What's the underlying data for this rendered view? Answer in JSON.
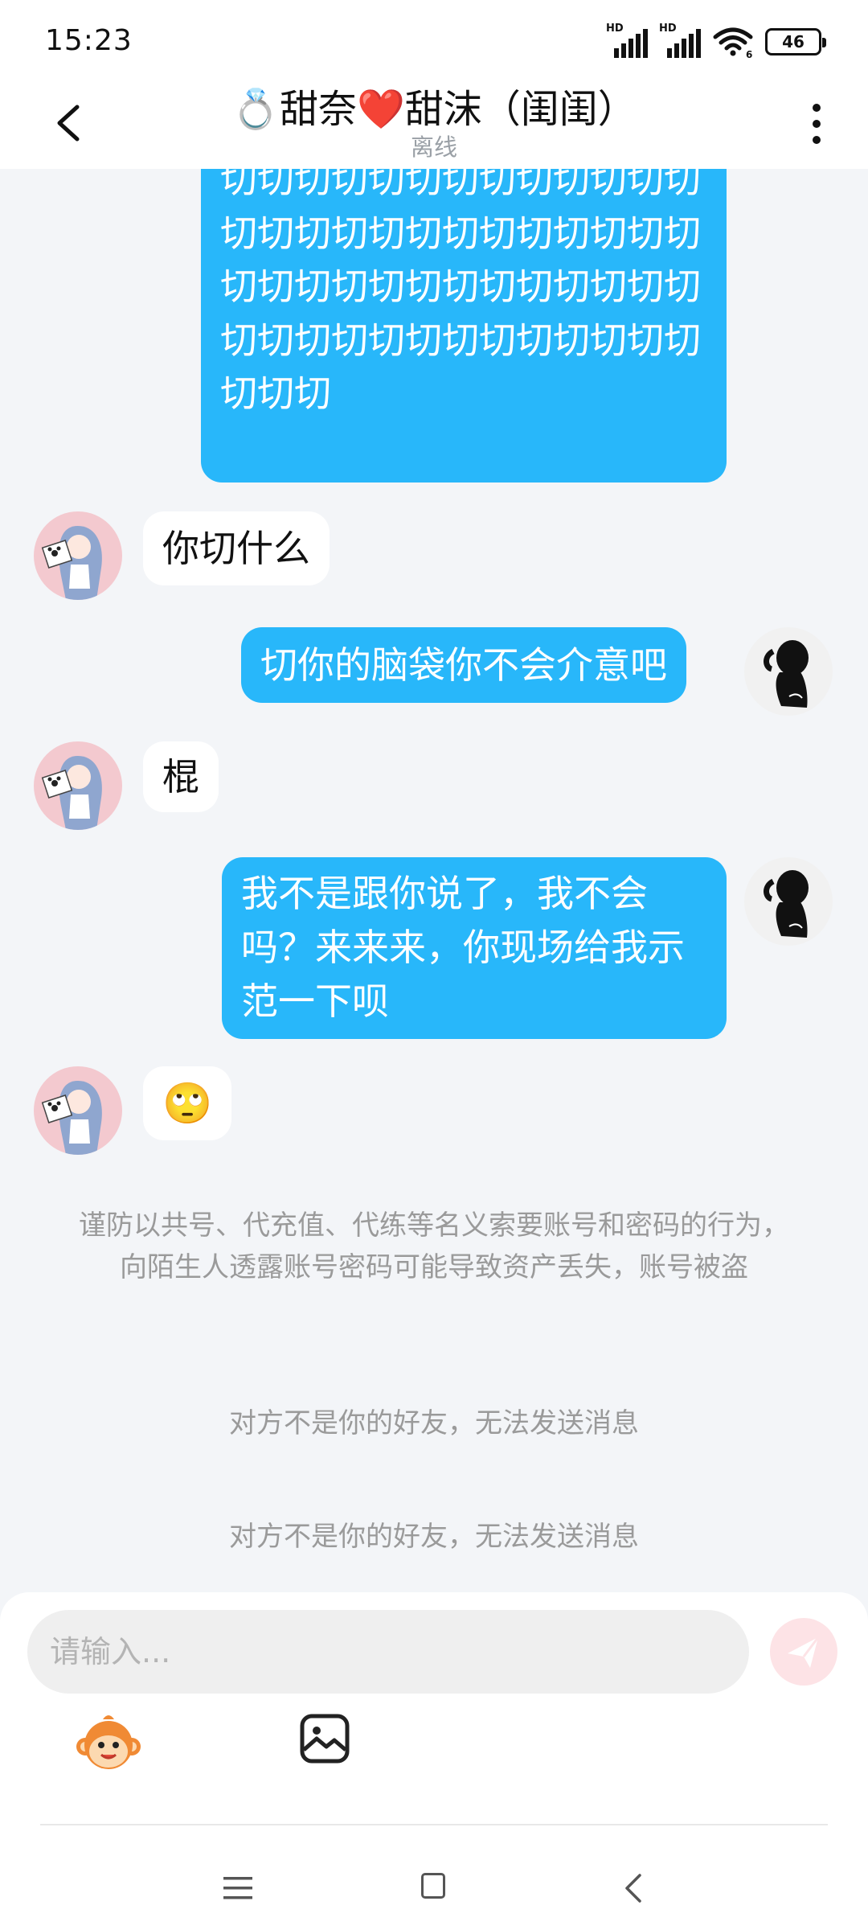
{
  "status_bar": {
    "time": "15:23",
    "hd1": "HD",
    "hd2": "HD",
    "wifi_badge": "6",
    "battery": "46"
  },
  "header": {
    "title": "💍甜奈❤️甜沫（闺闺）",
    "subtitle": "离线"
  },
  "messages": [
    {
      "side": "out",
      "text": "切切切切切切切切切切切切切切切切切切切切切切切切切切切切切切切切切切切切切切切切切切切切切切切切切切切切切切切"
    },
    {
      "side": "in",
      "text": "你切什么"
    },
    {
      "side": "out",
      "text": "切你的脑袋你不会介意吧"
    },
    {
      "side": "in",
      "text": "棍"
    },
    {
      "side": "out",
      "text": "我不是跟你说了，我不会吗？来来来，你现场给我示范一下呗"
    },
    {
      "side": "in",
      "text": "🙄"
    }
  ],
  "system_notices": [
    "谨防以共号、代充值、代练等名义索要账号和密码的行为，向陌生人透露账号密码可能导致资产丢失，账号被盗",
    "对方不是你的好友，无法发送消息",
    "对方不是你的好友，无法发送消息"
  ],
  "composer": {
    "placeholder": "请输入..."
  },
  "icons": {
    "back": "chevron-left-icon",
    "more": "more-vertical-icon",
    "send": "paper-plane-icon",
    "emoji": "monkey-emoji-icon",
    "image": "image-icon",
    "nav_menu": "menu-icon",
    "nav_home": "square-home-icon",
    "nav_back": "triangle-back-icon"
  },
  "colors": {
    "out_bubble": "#28b7fa",
    "in_bubble": "#ffffff",
    "background": "#f3f5f8",
    "send_button": "#fde3e6"
  }
}
